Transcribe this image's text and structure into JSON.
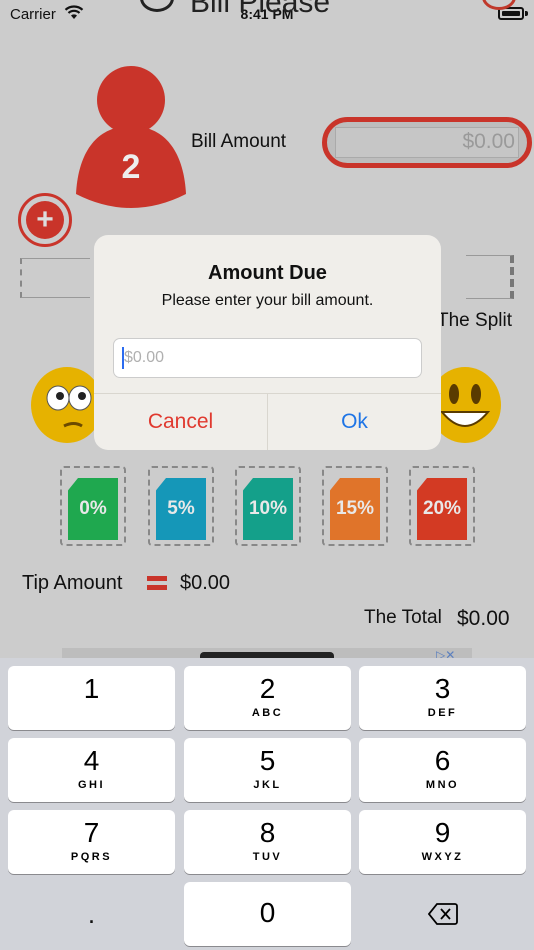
{
  "status_bar": {
    "carrier": "Carrier",
    "time": "8:41 PM"
  },
  "nav": {
    "title": "Bill Please"
  },
  "main": {
    "person_count": "2",
    "bill_label": "Bill Amount",
    "bill_value": "$0.00",
    "add_symbol": "+",
    "split_label": "The Split",
    "tip_buttons": [
      {
        "label": "0%",
        "color": "#1fa84f"
      },
      {
        "label": "5%",
        "color": "#1597b8"
      },
      {
        "label": "10%",
        "color": "#14a08a"
      },
      {
        "label": "15%",
        "color": "#e0742a"
      },
      {
        "label": "20%",
        "color": "#d33a23"
      }
    ],
    "tip_amount_label": "Tip Amount",
    "tip_amount_value": "$0.00",
    "total_label": "The Total",
    "total_value": "$0.00"
  },
  "alert": {
    "title": "Amount Due",
    "message": "Please enter your bill amount.",
    "input_placeholder": "$0.00",
    "cancel_label": "Cancel",
    "ok_label": "Ok"
  },
  "keyboard": {
    "keys": [
      {
        "num": "1",
        "letters": ""
      },
      {
        "num": "2",
        "letters": "ABC"
      },
      {
        "num": "3",
        "letters": "DEF"
      },
      {
        "num": "4",
        "letters": "GHI"
      },
      {
        "num": "5",
        "letters": "JKL"
      },
      {
        "num": "6",
        "letters": "MNO"
      },
      {
        "num": "7",
        "letters": "PQRS"
      },
      {
        "num": "8",
        "letters": "TUV"
      },
      {
        "num": "9",
        "letters": "WXYZ"
      },
      {
        "num": "0",
        "letters": ""
      }
    ],
    "decimal": "."
  },
  "colors": {
    "accent_red": "#c9342a",
    "alert_blue": "#1e74e6",
    "alert_red": "#e0392f"
  }
}
